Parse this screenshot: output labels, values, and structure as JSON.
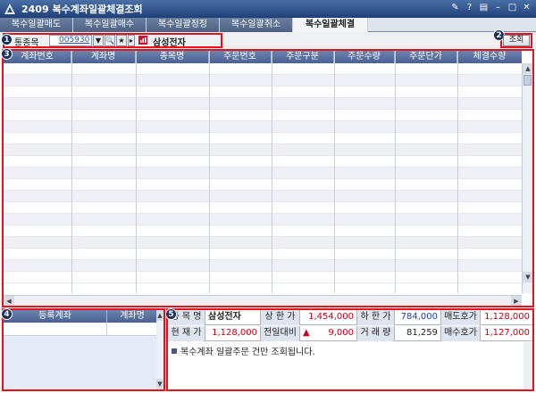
{
  "window": {
    "title": "2409 복수계좌일괄체결조회",
    "controls": [
      "pin-icon",
      "help-icon",
      "menu-icon",
      "minimize-icon",
      "maximize-icon",
      "close-icon"
    ]
  },
  "tabs": [
    {
      "label": "복수일괄매도",
      "active": false
    },
    {
      "label": "복수일괄매수",
      "active": false
    },
    {
      "label": "복수일괄정정",
      "active": false
    },
    {
      "label": "복수일괄취소",
      "active": false
    },
    {
      "label": "복수일괄체결",
      "active": true
    }
  ],
  "toolbar": {
    "stock_label": "통종목",
    "stock_code": "005930",
    "stock_name": "삼성전자",
    "query_label": "조회"
  },
  "badges": {
    "b1": "1",
    "b2": "2",
    "b3": "3",
    "b4": "4",
    "b5": "5"
  },
  "grid": {
    "columns": [
      "계좌번호",
      "계좌명",
      "종목명",
      "주문번호",
      "주문구분",
      "주문수량",
      "주문단가",
      "체결수량"
    ]
  },
  "accounts": {
    "columns": [
      "등록계좌",
      "계좌명"
    ]
  },
  "quote": {
    "row1": {
      "name_label": "종 목 명",
      "name": "삼성전자",
      "upper_label": "상 한 가",
      "upper": "1,454,000",
      "lower_label": "하 한 가",
      "lower": "784,000",
      "ask_label": "매도호가",
      "ask": "1,128,000"
    },
    "row2": {
      "price_label": "현 재 가",
      "price": "1,128,000",
      "change_label": "전일대비",
      "change": "9,000",
      "volume_label": "거 래 량",
      "volume": "81,259",
      "bid_label": "매수호가",
      "bid": "1,127,000"
    },
    "notice": "복수계좌 일괄주문 건만 조회됩니다."
  },
  "colors": {
    "accent_red": "#e0141e",
    "title_blue": "#1f3f78",
    "up_red": "#c4001a",
    "down_blue": "#1c3ea8"
  }
}
